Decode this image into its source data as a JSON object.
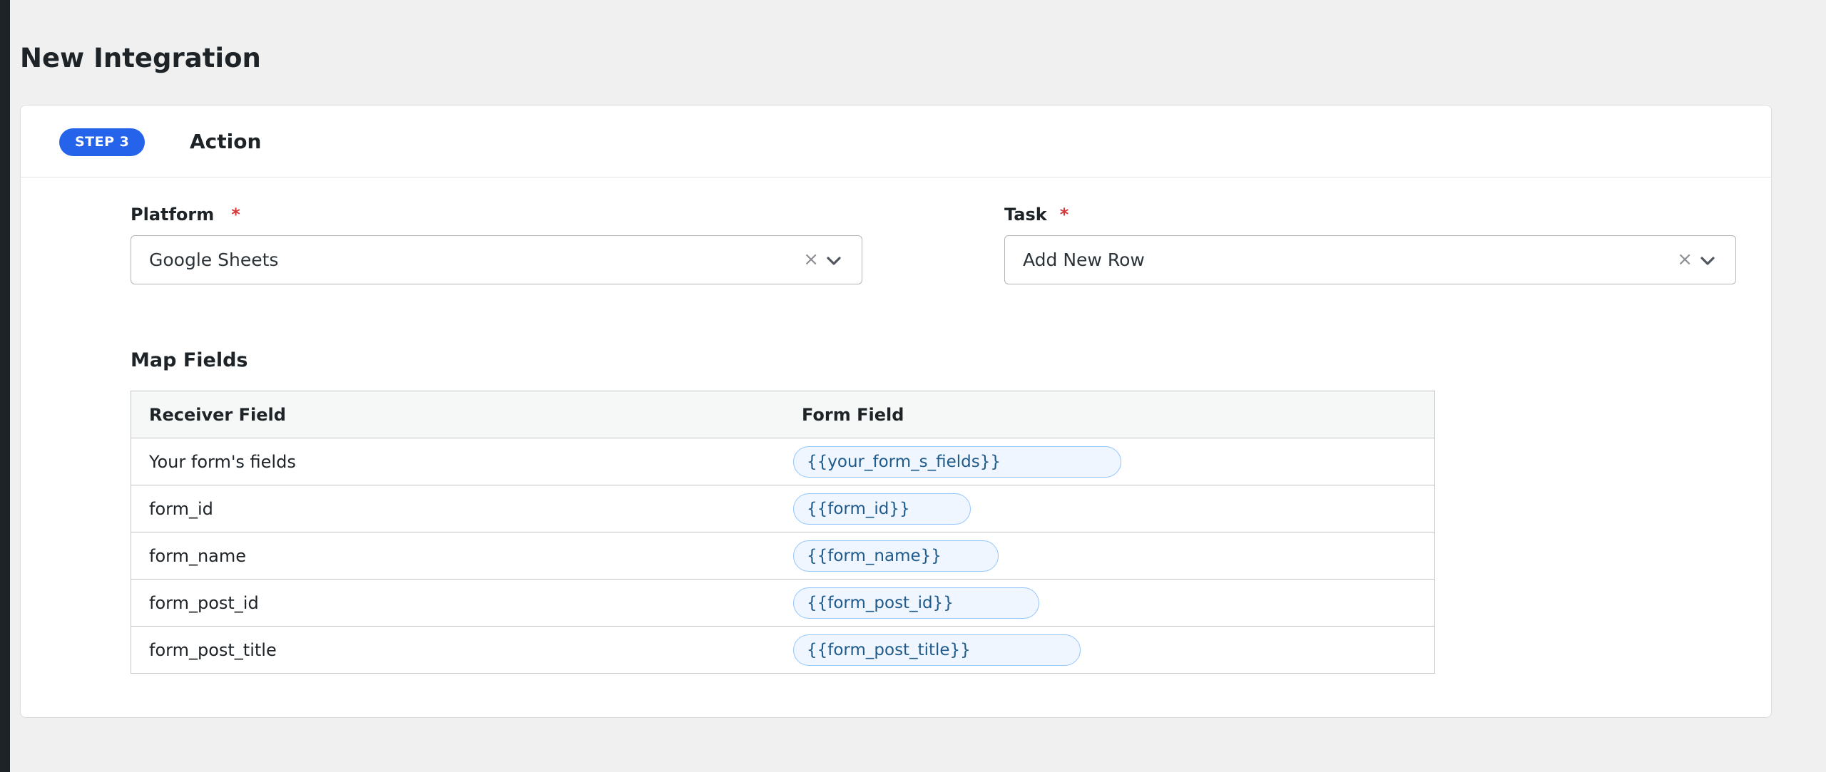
{
  "page": {
    "title": "New Integration"
  },
  "step": {
    "badge": "STEP 3",
    "title": "Action"
  },
  "fields": {
    "platform": {
      "label": "Platform",
      "required_mark": "*",
      "value": "Google Sheets",
      "clear_glyph": "×"
    },
    "task": {
      "label": "Task",
      "required_mark": "*",
      "value": "Add New Row",
      "clear_glyph": "×"
    }
  },
  "map_fields": {
    "title": "Map Fields",
    "headers": {
      "receiver": "Receiver Field",
      "form": "Form Field"
    },
    "rows": [
      {
        "receiver": "Your form's fields",
        "form": "{{your_form_s_fields}}"
      },
      {
        "receiver": "form_id",
        "form": "{{form_id}}"
      },
      {
        "receiver": "form_name",
        "form": "{{form_name}}"
      },
      {
        "receiver": "form_post_id",
        "form": "{{form_post_id}}"
      },
      {
        "receiver": "form_post_title",
        "form": "{{form_post_title}}"
      }
    ]
  },
  "colors": {
    "accent": "#2563eb",
    "required": "#d63638",
    "tag_bg": "#eff6ff",
    "tag_border": "#93c5fd",
    "tag_text": "#1e5a8a"
  },
  "icons": {
    "chevron": "chevron-down-icon",
    "clear": "clear-icon"
  }
}
